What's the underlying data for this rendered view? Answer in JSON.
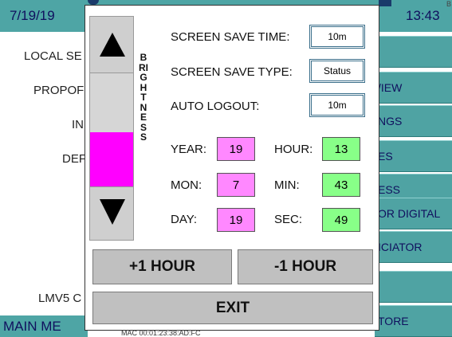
{
  "topbar": {
    "date": "7/19/19",
    "time": "13:43",
    "corner_mark": "B"
  },
  "left_labels": {
    "local": "LOCAL SE",
    "propor": "PROPOF",
    "in": "IN",
    "der": "DEF",
    "lmv5": "LMV5 C"
  },
  "right_buttons": [
    "",
    "/IEW",
    "NGS",
    "ES",
    "ESS",
    "OR DIGITAL",
    "ICIATOR",
    "",
    "TORE"
  ],
  "main_menu": "MAIN ME",
  "mac": "MAC 00:01:23:38:AD:FC",
  "dialog": {
    "brightness_label": "BRIGHTNESS",
    "screen_save_time_label": "SCREEN SAVE TIME:",
    "screen_save_time_value": "10m",
    "screen_save_type_label": "SCREEN SAVE TYPE:",
    "screen_save_type_value": "Status",
    "auto_logout_label": "AUTO LOGOUT:",
    "auto_logout_value": "10m",
    "year_label": "YEAR:",
    "year_value": "19",
    "mon_label": "MON:",
    "mon_value": "7",
    "day_label": "DAY:",
    "day_value": "19",
    "hour_label": "HOUR:",
    "hour_value": "13",
    "min_label": "MIN:",
    "min_value": "43",
    "sec_label": "SEC:",
    "sec_value": "49",
    "plus_hour": "+1 HOUR",
    "minus_hour": "-1 HOUR",
    "exit": "EXIT"
  },
  "colors": {
    "teal": "#4ea5a5",
    "date_fill": "#ff88ff",
    "time_fill": "#88ff88",
    "brightness_fill": "#ff00ff"
  }
}
